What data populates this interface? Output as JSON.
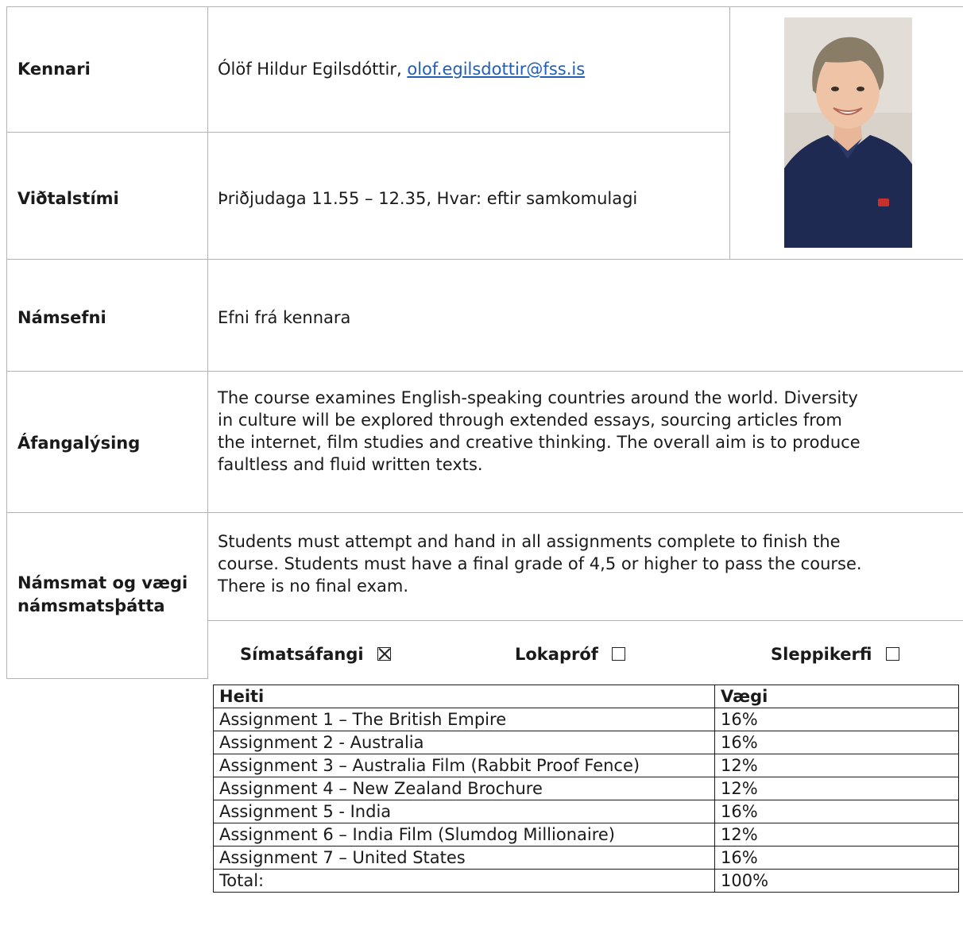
{
  "teacher": {
    "label": "Kennari",
    "name": "Ólöf Hildur Egilsdóttir,",
    "email": "olof.egilsdottir@fss.is"
  },
  "interview": {
    "label": "Viðtalstími",
    "value": "Þriðjudaga 11.55 – 12.35, Hvar: eftir samkomulagi"
  },
  "material": {
    "label": "Námsefni",
    "value": "Efni frá kennara"
  },
  "description": {
    "label": "Áfangalýsing",
    "lines": [
      "The course examines English-speaking countries around the world. Diversity",
      "in culture will be explored through extended essays, sourcing articles from",
      "the internet, film studies and creative thinking. The overall aim is to produce",
      "faultless and fluid written texts."
    ]
  },
  "assessment": {
    "label_line1": "Námsmat og vægi",
    "label_line2": "námsmatsþátta",
    "lines": [
      "Students must attempt and hand in all assignments complete to finish the",
      "course. Students must have a final grade of 4,5 or higher to pass the course.",
      "There is no final exam."
    ],
    "options": [
      {
        "label": "Símatsáfangi",
        "checked": true
      },
      {
        "label": "Lokapróf",
        "checked": false
      },
      {
        "label": "Sleppikerfi",
        "checked": false
      }
    ]
  },
  "grades_table": {
    "headers": [
      "Heiti",
      "Vægi"
    ],
    "rows": [
      [
        "Assignment 1 – The British Empire",
        "16%"
      ],
      [
        "Assignment 2 - Australia",
        "16%"
      ],
      [
        "Assignment 3 – Australia Film (Rabbit Proof Fence)",
        "12%"
      ],
      [
        "Assignment 4 – New Zealand Brochure",
        "12%"
      ],
      [
        "Assignment 5 - India",
        "16%"
      ],
      [
        "Assignment 6 – India Film (Slumdog Millionaire)",
        "12%"
      ],
      [
        "Assignment 7 – United States",
        "16%"
      ],
      [
        "Total:",
        "100%"
      ]
    ]
  }
}
